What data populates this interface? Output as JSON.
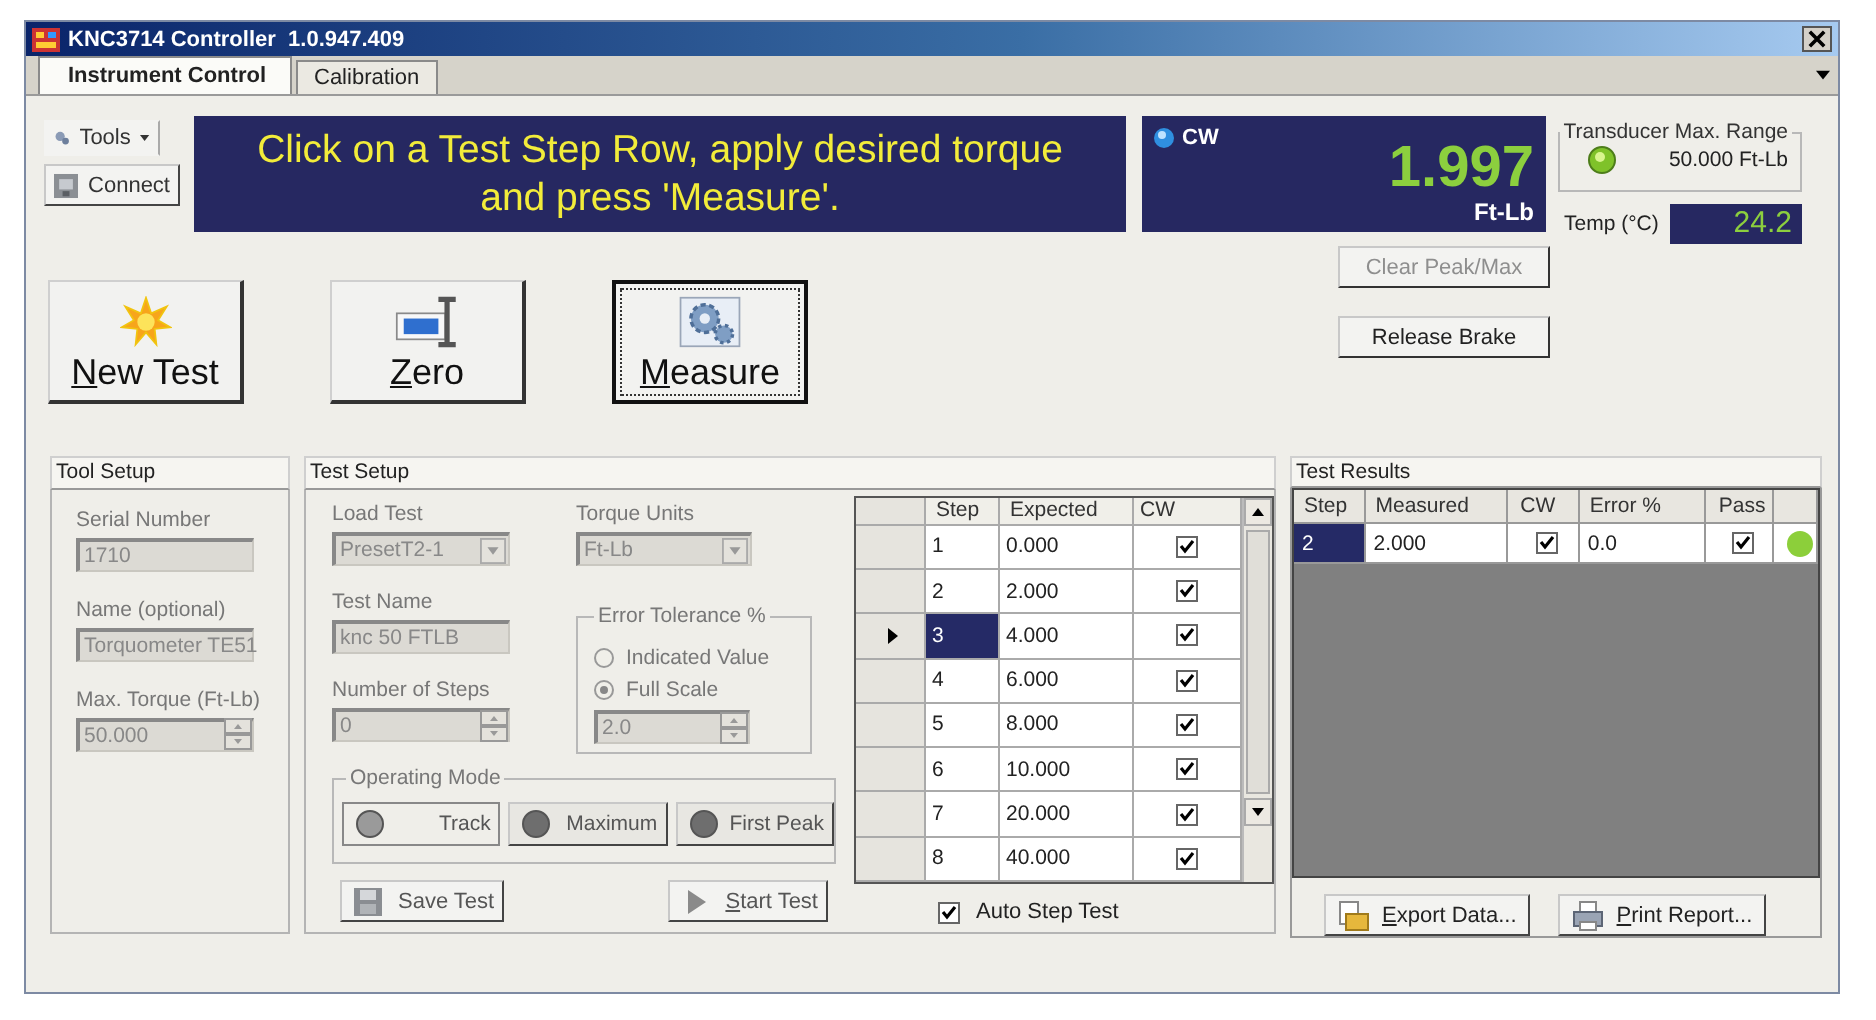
{
  "window": {
    "title": "KNC3714 Controller  1.0.947.409"
  },
  "tabs": [
    {
      "label": "Instrument Control",
      "selected": true
    },
    {
      "label": "Calibration",
      "selected": false
    }
  ],
  "toolbar": {
    "tools": "Tools",
    "connect": "Connect"
  },
  "message": [
    "Click on a Test Step Row, apply desired torque",
    "and press 'Measure'."
  ],
  "reading": {
    "direction": "CW",
    "value": "1.997",
    "unit": "Ft-Lb"
  },
  "transducer": {
    "title": "Transducer Max. Range",
    "value": "50.000 Ft-Lb"
  },
  "temperature": {
    "label": "Temp (°C)",
    "value": "24.2"
  },
  "side_buttons": [
    {
      "label": "Clear Peak/Max",
      "disabled": true
    },
    {
      "label": "Release Brake",
      "disabled": false
    }
  ],
  "actions": [
    {
      "label": "New Test",
      "kind": "new",
      "mnemonic": true,
      "focused": false
    },
    {
      "label": "Zero",
      "kind": "zero",
      "mnemonic": true,
      "focused": false
    },
    {
      "label": "Measure",
      "kind": "measure",
      "mnemonic": true,
      "focused": true
    }
  ],
  "tool_setup": {
    "title": "Tool Setup",
    "fields": [
      {
        "label": "Serial Number",
        "value": "1710",
        "kind": "text"
      },
      {
        "label": "Name (optional)",
        "value": "Torquometer TE51",
        "kind": "text"
      },
      {
        "label": "Max. Torque (Ft-Lb)",
        "value": "50.000",
        "kind": "spin"
      }
    ]
  },
  "test_setup": {
    "title": "Test Setup",
    "load_test": {
      "label": "Load Test",
      "value": "PresetT2-1"
    },
    "torque_units": {
      "label": "Torque Units",
      "value": "Ft-Lb"
    },
    "test_name": {
      "label": "Test Name",
      "value": "knc 50 FTLB"
    },
    "steps": {
      "label": "Number of Steps",
      "value": "0"
    },
    "error_tolerance": {
      "title": "Error Tolerance %",
      "options": [
        {
          "label": "Indicated Value",
          "selected": false
        },
        {
          "label": "Full Scale",
          "selected": true
        }
      ],
      "value": "2.0"
    },
    "operating_mode": {
      "title": "Operating Mode",
      "modes": [
        {
          "label": "Track",
          "selected": true
        },
        {
          "label": "Maximum",
          "selected": false
        },
        {
          "label": "First Peak",
          "selected": false
        }
      ]
    },
    "buttons": [
      {
        "label": "Save Test",
        "kind": "save",
        "mnemonic": false
      },
      {
        "label": "Start Test",
        "kind": "start",
        "mnemonic": true
      }
    ],
    "step_grid": {
      "columns": [
        "Step",
        "Expected",
        "CW"
      ],
      "rows": [
        {
          "step": "1",
          "expected": "0.000",
          "cw": true,
          "selected": false
        },
        {
          "step": "2",
          "expected": "2.000",
          "cw": true,
          "selected": false
        },
        {
          "step": "3",
          "expected": "4.000",
          "cw": true,
          "selected": true
        },
        {
          "step": "4",
          "expected": "6.000",
          "cw": true,
          "selected": false
        },
        {
          "step": "5",
          "expected": "8.000",
          "cw": true,
          "selected": false
        },
        {
          "step": "6",
          "expected": "10.000",
          "cw": true,
          "selected": false
        },
        {
          "step": "7",
          "expected": "20.000",
          "cw": true,
          "selected": false
        },
        {
          "step": "8",
          "expected": "40.000",
          "cw": true,
          "selected": false
        }
      ]
    },
    "auto_step": {
      "label": "Auto Step Test",
      "checked": true
    }
  },
  "test_results": {
    "title": "Test Results",
    "columns": [
      "Step",
      "Measured",
      "CW",
      "Error %",
      "Pass"
    ],
    "rows": [
      {
        "step": "2",
        "measured": "2.000",
        "cw": true,
        "error": "0.0",
        "pass": true,
        "selected": true,
        "color": "#8ccf3a"
      }
    ],
    "buttons": [
      {
        "label": "Export Data...",
        "kind": "export",
        "mnemonic": true
      },
      {
        "label": "Print Report...",
        "kind": "print",
        "mnemonic": true
      }
    ]
  }
}
